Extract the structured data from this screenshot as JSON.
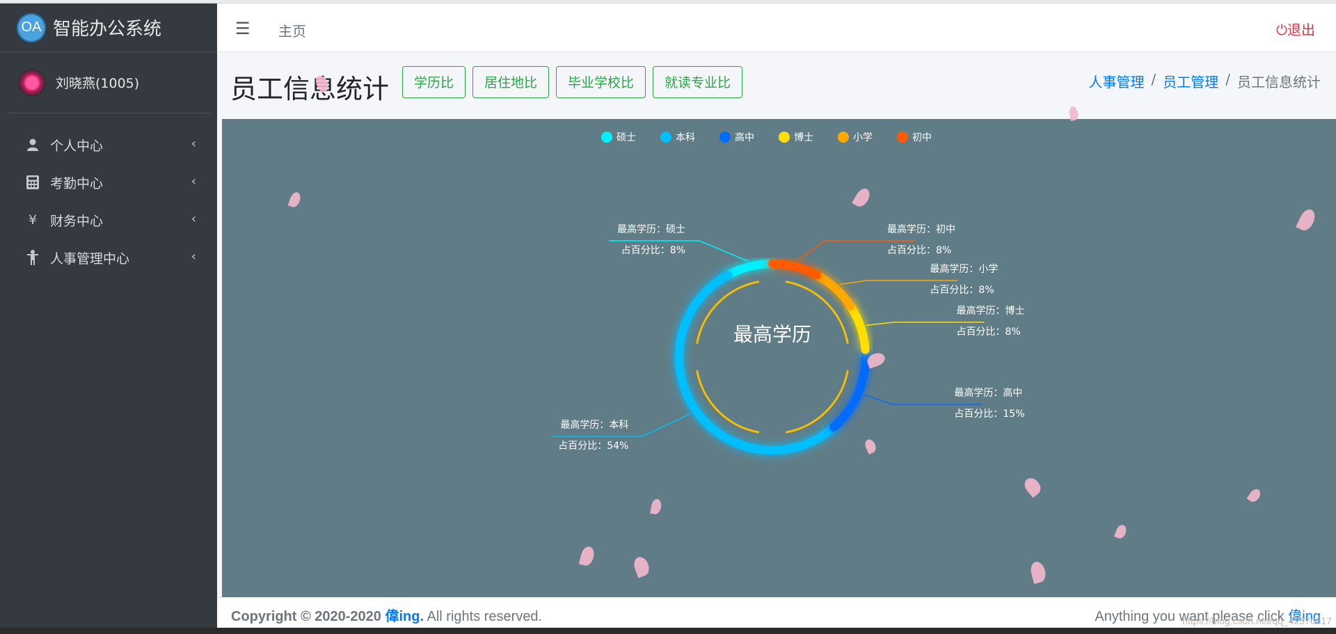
{
  "app": {
    "logo_text": "OA",
    "title": "智能办公系统",
    "user": "刘晓燕(1005)"
  },
  "sidebar": {
    "items": [
      {
        "label": "个人中心",
        "icon": "user-icon"
      },
      {
        "label": "考勤中心",
        "icon": "calculator-icon"
      },
      {
        "label": "财务中心",
        "icon": "yen-icon"
      },
      {
        "label": "人事管理中心",
        "icon": "person-icon"
      }
    ]
  },
  "navbar": {
    "menu_icon": "☰",
    "home": "主页",
    "logout": "退出"
  },
  "header": {
    "title": "员工信息统计",
    "buttons": [
      "学历比",
      "居住地比",
      "毕业学校比",
      "就读专业比"
    ],
    "breadcrumb": [
      "人事管理",
      "员工管理",
      "员工信息统计"
    ]
  },
  "chart_data": {
    "type": "pie",
    "title": "最高学历",
    "legend_position": "top",
    "label_prefix_category": "最高学历：",
    "label_prefix_percent": "占百分比：",
    "series": [
      {
        "name": "硕士",
        "value": 8,
        "label_percent": "8%",
        "color": "#00f0ff"
      },
      {
        "name": "本科",
        "value": 54,
        "label_percent": "54%",
        "color": "#00bfff"
      },
      {
        "name": "高中",
        "value": 15,
        "label_percent": "15%",
        "color": "#006cff"
      },
      {
        "name": "博士",
        "value": 8,
        "label_percent": "8%",
        "color": "#ffe000"
      },
      {
        "name": "小学",
        "value": 8,
        "label_percent": "8%",
        "color": "#ffa800"
      },
      {
        "name": "初中",
        "value": 8,
        "label_percent": "8%",
        "color": "#ff5b00"
      }
    ]
  },
  "footer": {
    "copyright_prefix": "Copyright © 2020-2020",
    "brand": "偉ing.",
    "rights": "All rights reserved.",
    "right_text": "Anything you want please click",
    "right_link": "偉ing"
  },
  "watermark": "https://blog.csdn.net/qq_42376617",
  "colors": {
    "sidebar_bg": "#343a40",
    "chart_bg": "#607d87",
    "accent_green": "#28a745",
    "link_blue": "#007bff",
    "logout_red": "#dc3545"
  }
}
